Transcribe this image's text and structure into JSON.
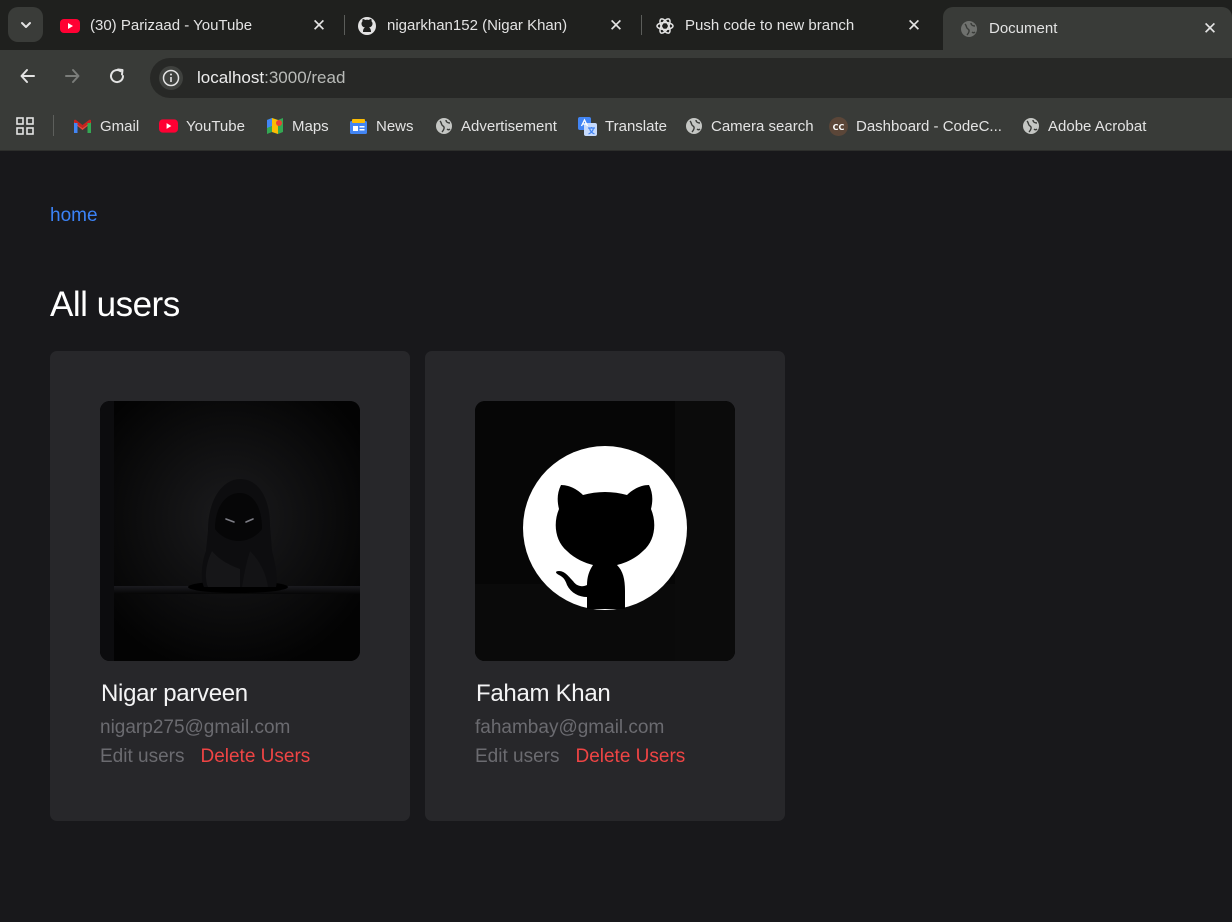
{
  "browser": {
    "tabs": [
      {
        "title": "(30) Parizaad - YouTube",
        "icon": "youtube-icon",
        "active": false
      },
      {
        "title": "nigarkhan152 (Nigar Khan)",
        "icon": "github-icon",
        "active": false
      },
      {
        "title": "Push code to new branch",
        "icon": "chatgpt-icon",
        "active": false
      },
      {
        "title": "Document",
        "icon": "globe-icon",
        "active": true
      }
    ],
    "close_glyph": "✕",
    "url_host": "localhost",
    "url_rest": ":3000/read",
    "bookmarks": [
      {
        "label": "Gmail",
        "icon": "gmail-icon"
      },
      {
        "label": "YouTube",
        "icon": "youtube-icon"
      },
      {
        "label": "Maps",
        "icon": "maps-icon"
      },
      {
        "label": "News",
        "icon": "news-icon"
      },
      {
        "label": "Advertisement",
        "icon": "globe-icon"
      },
      {
        "label": "Translate",
        "icon": "translate-icon"
      },
      {
        "label": "Camera search",
        "icon": "globe-icon"
      },
      {
        "label": "Dashboard - CodeC...",
        "icon": "codechef-icon"
      },
      {
        "label": "Adobe Acrobat",
        "icon": "globe-icon"
      }
    ],
    "codechef_badge": "CC"
  },
  "page": {
    "home_link": "home",
    "title": "All users",
    "users": [
      {
        "name": "Nigar parveen",
        "email": "nigarp275@gmail.com",
        "edit_label": "Edit users",
        "delete_label": "Delete Users"
      },
      {
        "name": "Faham Khan",
        "email": "fahambay@gmail.com",
        "edit_label": "Edit users",
        "delete_label": "Delete Users"
      }
    ]
  },
  "colors": {
    "page_bg": "#18181b",
    "card_bg": "#27272a",
    "link_blue": "#3b82f6",
    "delete_red": "#ef4444",
    "muted_text": "#6b6b70"
  }
}
